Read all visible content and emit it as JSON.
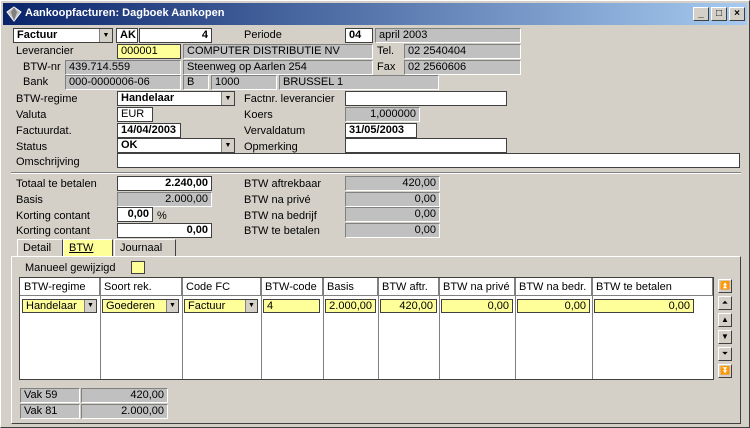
{
  "window": {
    "title": "Aankoopfacturen: Dagboek Aankopen",
    "icon": "diamond-app-icon"
  },
  "header": {
    "doc_type": "Factuur",
    "journal_code": "AK",
    "doc_number": "4",
    "period_label": "Periode",
    "period_number": "04",
    "period_name": "april 2003"
  },
  "supplier": {
    "label": "Leverancier",
    "code": "000001",
    "name": "COMPUTER DISTRIBUTIE NV",
    "tel_label": "Tel.",
    "tel": "02 2540404",
    "vat_label": "BTW-nr",
    "vat": "439.714.559",
    "address": "Steenweg op Aarlen 254",
    "fax_label": "Fax",
    "fax": "02 2560606",
    "bank_label": "Bank",
    "bank": "000-0000006-06",
    "country": "B",
    "postcode": "1000",
    "city": "BRUSSEL 1"
  },
  "details": {
    "vat_regime_label": "BTW-regime",
    "vat_regime": "Handelaar",
    "supplier_invoice_label": "Factnr. leverancier",
    "supplier_invoice": "",
    "currency_label": "Valuta",
    "currency": "EUR",
    "rate_label": "Koers",
    "rate": "1,000000",
    "invoice_date_label": "Factuurdat.",
    "invoice_date": "14/04/2003",
    "due_date_label": "Vervaldatum",
    "due_date": "31/05/2003",
    "status_label": "Status",
    "status": "OK",
    "remark_label": "Opmerking",
    "remark": "",
    "description_label": "Omschrijving",
    "description": ""
  },
  "totals": {
    "total_label": "Totaal te betalen",
    "total": "2.240,00",
    "basis_label": "Basis",
    "basis": "2.000,00",
    "discount_pct_label": "Korting contant",
    "discount_pct": "0,00",
    "pct_sign": "%",
    "discount_amount_label": "Korting contant",
    "discount_amount": "0,00",
    "vat_deductible_label": "BTW aftrekbaar",
    "vat_deductible": "420,00",
    "vat_private_label": "BTW na privé",
    "vat_private": "0,00",
    "vat_company_label": "BTW na bedrijf",
    "vat_company": "0,00",
    "vat_payable_label": "BTW te betalen",
    "vat_payable": "0,00"
  },
  "tabs": [
    {
      "label": "Detail"
    },
    {
      "label": "BTW"
    },
    {
      "label": "Journaal"
    }
  ],
  "vat_tab": {
    "manual_label": "Manueel gewijzigd",
    "columns": [
      "BTW-regime",
      "Soort rek.",
      "Code FC",
      "BTW-code",
      "Basis",
      "BTW aftr.",
      "BTW na privé",
      "BTW na bedr.",
      "BTW te betalen"
    ],
    "row": {
      "regime": "Handelaar",
      "account_type": "Goederen",
      "code_fc": "Factuur",
      "vat_code": "4",
      "basis": "2.000,00",
      "vat_deductible": "420,00",
      "vat_private": "0,00",
      "vat_company": "0,00",
      "vat_payable": "0,00"
    },
    "boxes": [
      {
        "label": "Vak 59",
        "value": "420,00"
      },
      {
        "label": "Vak 81",
        "value": "2.000,00"
      }
    ]
  },
  "colors": {
    "highlight": "#ffff99",
    "titlebar": "#0a246a",
    "face": "#d4d0c8"
  }
}
